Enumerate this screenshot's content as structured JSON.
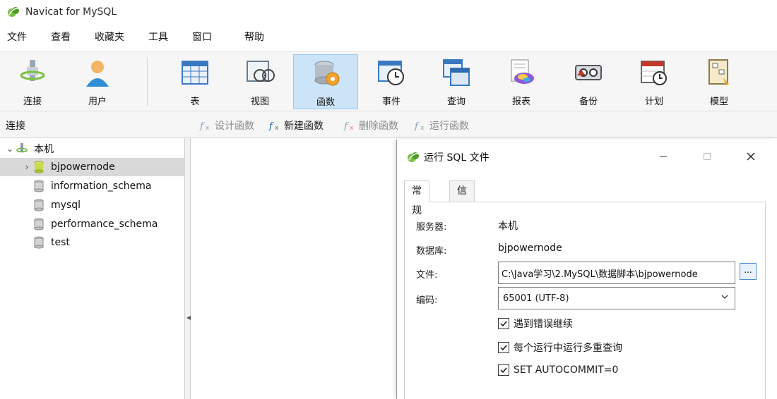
{
  "app": {
    "title": "Navicat for MySQL"
  },
  "menu": [
    "文件",
    "查看",
    "收藏夹",
    "工具",
    "窗口",
    "帮助"
  ],
  "toolbar": {
    "items": [
      {
        "label": "连接",
        "icon": "plug-icon"
      },
      {
        "label": "用户",
        "icon": "user-icon"
      },
      {
        "label": "表",
        "icon": "table-icon"
      },
      {
        "label": "视图",
        "icon": "view-icon"
      },
      {
        "label": "函数",
        "icon": "function-icon",
        "active": true
      },
      {
        "label": "事件",
        "icon": "event-clock-icon"
      },
      {
        "label": "查询",
        "icon": "query-icon"
      },
      {
        "label": "报表",
        "icon": "report-icon"
      },
      {
        "label": "备份",
        "icon": "backup-icon"
      },
      {
        "label": "计划",
        "icon": "schedule-icon"
      },
      {
        "label": "模型",
        "icon": "model-icon"
      }
    ]
  },
  "subbar": {
    "pane_title": "连接",
    "actions": [
      {
        "label": "设计函数",
        "icon": "design-function-icon",
        "enabled": false
      },
      {
        "label": "新建函数",
        "icon": "new-function-icon",
        "enabled": true
      },
      {
        "label": "删除函数",
        "icon": "delete-function-icon",
        "enabled": false
      },
      {
        "label": "运行函数",
        "icon": "run-function-icon",
        "enabled": false
      }
    ]
  },
  "tree": {
    "root": {
      "label": "本机",
      "expanded": true
    },
    "databases": [
      {
        "label": "bjpowernode",
        "selected": true,
        "open": true
      },
      {
        "label": "information_schema"
      },
      {
        "label": "mysql"
      },
      {
        "label": "performance_schema"
      },
      {
        "label": "test"
      }
    ]
  },
  "dialog": {
    "title": "运行 SQL 文件",
    "tabs": [
      "常规",
      "信息日志"
    ],
    "active_tab": 0,
    "fields": {
      "server_label": "服务器:",
      "server_value": "本机",
      "database_label": "数据库:",
      "database_value": "bjpowernode",
      "file_label": "文件:",
      "file_value": "C:\\Java学习\\2.MySQL\\数据脚本\\bjpowernode",
      "browse_label": "...",
      "encoding_label": "编码:",
      "encoding_value": "65001 (UTF-8)"
    },
    "checks": [
      {
        "label": "遇到错误继续",
        "checked": true
      },
      {
        "label": "每个运行中运行多重查询",
        "checked": true
      },
      {
        "label": "SET AUTOCOMMIT=0",
        "checked": true
      }
    ]
  },
  "colors": {
    "accent": "#cce4f7",
    "navicat_green": "#6ab33e",
    "selection": "#d9d9d9"
  }
}
